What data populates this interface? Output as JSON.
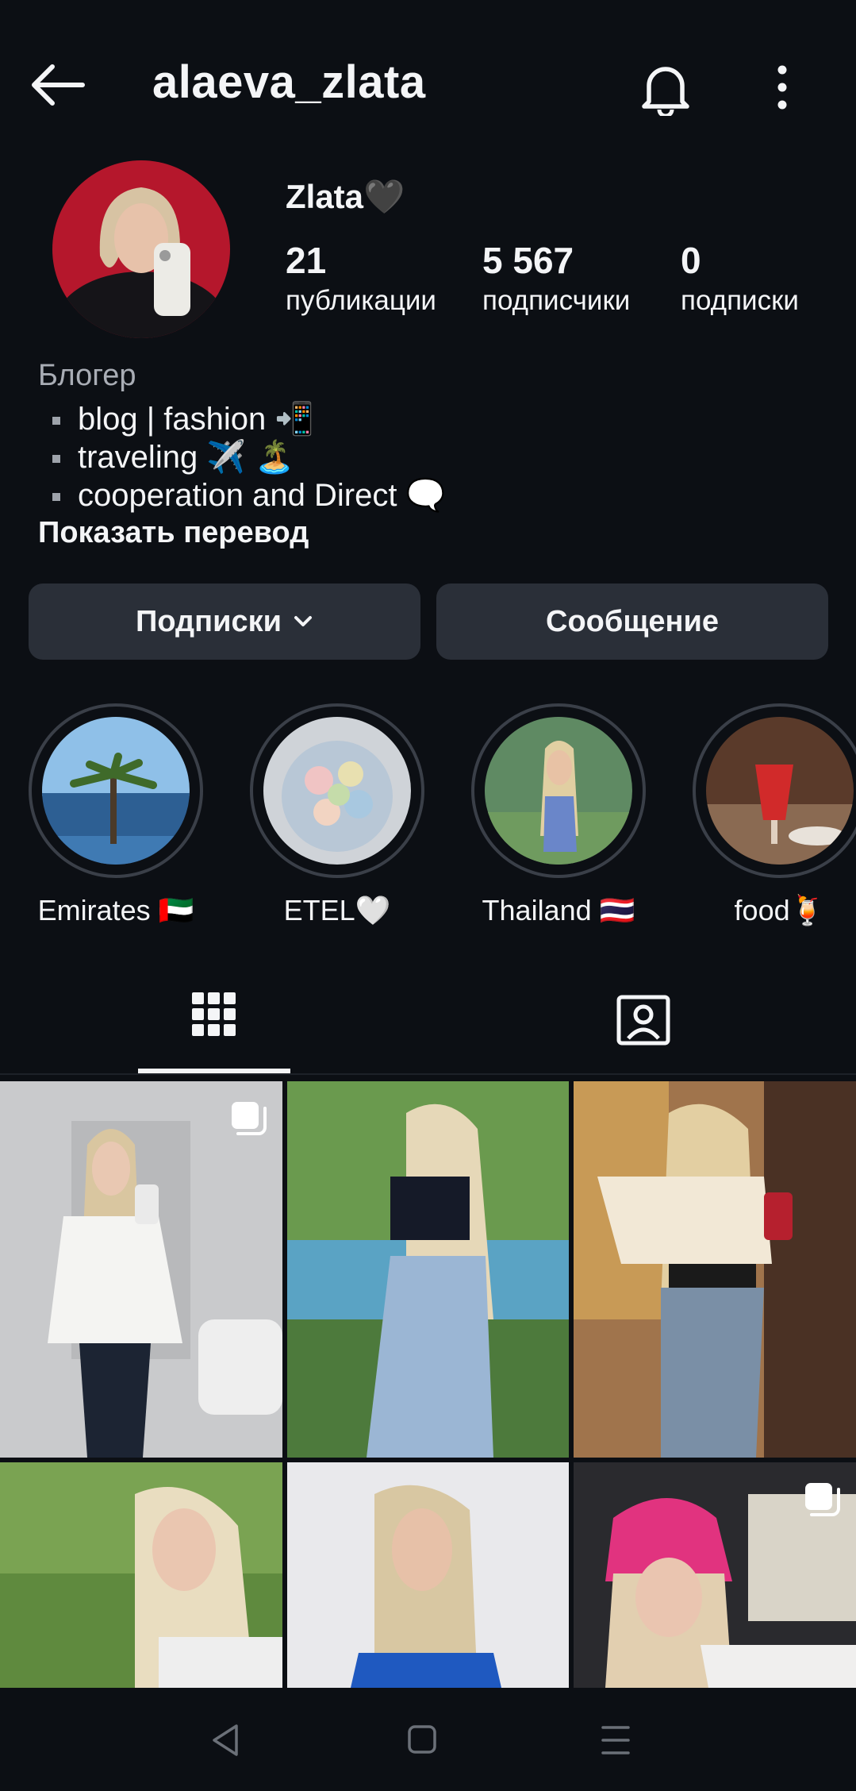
{
  "header": {
    "username": "alaeva_zlata",
    "icons": [
      "back-arrow-icon",
      "bell-icon",
      "more-vertical-icon"
    ]
  },
  "profile": {
    "display_name": "Zlata🖤",
    "stats": [
      {
        "value": "21",
        "label": "публикации"
      },
      {
        "value": "5 567",
        "label": "подписчики"
      },
      {
        "value": "0",
        "label": "подписки"
      }
    ],
    "category": "Блогер",
    "bio": [
      "blog | fashion 📲",
      "traveling ✈️ 🏝️",
      "cooperation and Direct 🗨️"
    ],
    "translate_link": "Показать перевод"
  },
  "actions": {
    "following_label": "Подписки",
    "message_label": "Сообщение"
  },
  "highlights": [
    {
      "label": "Emirates 🇦🇪"
    },
    {
      "label": "ETEL🤍"
    },
    {
      "label": "Thailand 🇹🇭"
    },
    {
      "label": "food🍹"
    }
  ],
  "tabs": {
    "active": "grid",
    "items": [
      "grid-icon",
      "tagged-icon"
    ]
  },
  "colors": {
    "background": "#0c0f14",
    "button": "#2a2f38",
    "text": "#f4f5f7",
    "muted": "#a9adb5"
  }
}
